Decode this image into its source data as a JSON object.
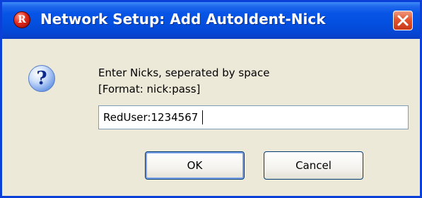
{
  "window": {
    "title": "Network Setup: Add AutoIdent-Nick",
    "app_icon_glyph": "R",
    "app_icon_name": "app-logo-icon",
    "close_icon_name": "close-icon",
    "titlebar_color": "#0450e0",
    "close_color": "#e2552f"
  },
  "dialog": {
    "icon_glyph": "?",
    "icon_name": "question-icon",
    "prompt_line1": "Enter Nicks, seperated by space",
    "prompt_line2": "[Format: nick:pass]",
    "input_value": "RedUser:1234567",
    "ok_label": "OK",
    "cancel_label": "Cancel"
  }
}
